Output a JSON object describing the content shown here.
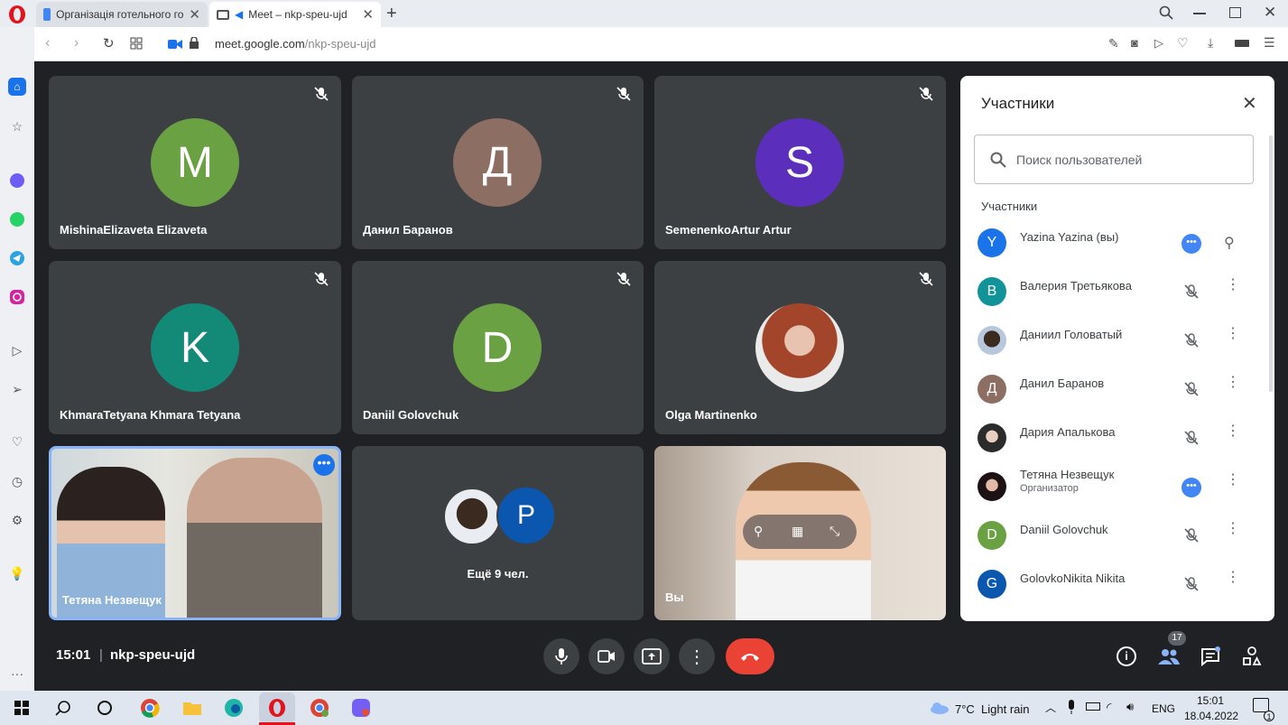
{
  "browser": {
    "tabs": [
      {
        "label": "Організація готельного го",
        "active": false
      },
      {
        "label": "Meet – nkp-speu-ujd",
        "active": true
      }
    ],
    "url_host": "meet.google.com",
    "url_path": "/nkp-speu-ujd"
  },
  "tiles": [
    {
      "name": "MishinaElizaveta Elizaveta",
      "initial": "M",
      "color": "#6aa143"
    },
    {
      "name": "Данил Баранов",
      "initial": "Д",
      "color": "#8d6e63"
    },
    {
      "name": "SemenenkoArtur Artur",
      "initial": "S",
      "color": "#5b2ebc"
    },
    {
      "name": "KhmaraTetyana Khmara Tetyana",
      "initial": "K",
      "color": "#138a77"
    },
    {
      "name": "Daniil Golovchuk",
      "initial": "D",
      "color": "#6aa143"
    },
    {
      "name": "Olga Martinenko",
      "initial": "",
      "color": "#7a3b2c"
    }
  ],
  "video_tile": {
    "name": "Тетяна Незвещук"
  },
  "more_tile": {
    "avatar_initial": "P",
    "label": "Ещё 9 чел."
  },
  "self_tile": {
    "name": "Вы"
  },
  "panel": {
    "title": "Участники",
    "search_placeholder": "Поиск пользователей",
    "section_label": "Участники",
    "participants": [
      {
        "name": "Yazina Yazina (вы)",
        "role": "",
        "initial": "Y",
        "color": "#1a73e8"
      },
      {
        "name": "Валерия Третьякова",
        "role": "",
        "initial": "В",
        "color": "#12939a"
      },
      {
        "name": "Даниил Головатый",
        "role": "",
        "initial": "",
        "color": "#5a4a3a"
      },
      {
        "name": "Данил Баранов",
        "role": "",
        "initial": "Д",
        "color": "#8d6e63"
      },
      {
        "name": "Дария Апалькова",
        "role": "",
        "initial": "",
        "color": "#3a3a3a"
      },
      {
        "name": "Тетяна Незвещук",
        "role": "Организатор",
        "initial": "",
        "color": "#2a1a1e"
      },
      {
        "name": "Daniil Golovchuk",
        "role": "",
        "initial": "D",
        "color": "#6aa143"
      },
      {
        "name": "GolovkoNikita Nikita",
        "role": "",
        "initial": "G",
        "color": "#0b57b0"
      }
    ]
  },
  "bottom": {
    "time": "15:01",
    "meeting_code": "nkp-speu-ujd",
    "participant_count": "17"
  },
  "taskbar": {
    "weather": "7°C  Light rain",
    "lang": "ENG",
    "clock_time": "15:01",
    "clock_date": "18.04.2022",
    "notifications": "1"
  }
}
